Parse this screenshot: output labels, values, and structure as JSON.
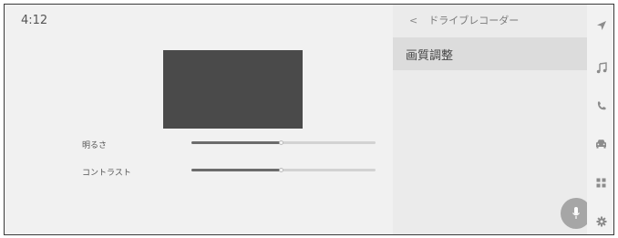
{
  "status": {
    "clock": "4:12"
  },
  "left_panel": {
    "rows": [
      {
        "label": "明るさ",
        "value": 0.49
      },
      {
        "label": "コントラスト",
        "value": 0.49
      }
    ]
  },
  "right_panel": {
    "header": {
      "back_glyph": "<",
      "title": "ドライブレコーダー"
    },
    "menu_items": [
      {
        "label": "画質調整"
      }
    ]
  },
  "rail": {
    "icons": [
      "navigation-arrow-icon",
      "music-note-icon",
      "phone-icon",
      "car-icon",
      "apps-grid-icon",
      "settings-gear-icon"
    ]
  },
  "colors": {
    "preview_fill": "#4a4a4a",
    "slider_fill": "#6c6c6c",
    "slider_track": "#d2d2d2",
    "selected_item": "#dcdcdc",
    "mic_button": "#a6a6a6"
  }
}
